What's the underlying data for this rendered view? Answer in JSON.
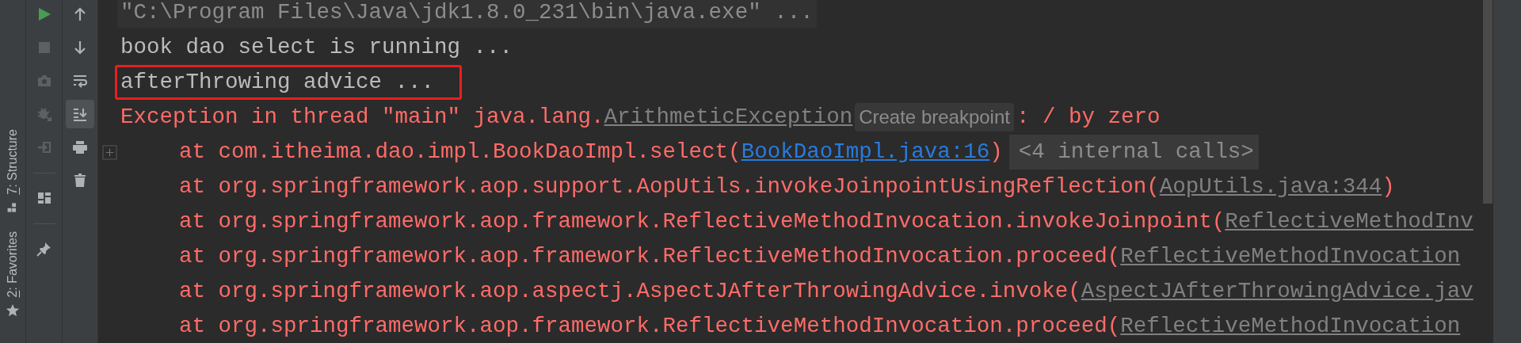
{
  "tool_stripe": [
    {
      "kind": "structure",
      "mnemonic": "7",
      "label": ": Structure"
    },
    {
      "kind": "favorites",
      "mnemonic": "2",
      "label": ": Favorites"
    }
  ],
  "run_toolbar": [
    {
      "kind": "run",
      "disabled": false
    },
    {
      "kind": "stop",
      "disabled": true
    },
    {
      "kind": "snapshot",
      "disabled": true
    },
    {
      "kind": "debug",
      "disabled": true
    },
    {
      "kind": "exit",
      "disabled": true
    },
    {
      "kind": "separator"
    },
    {
      "kind": "layout",
      "disabled": false
    },
    {
      "kind": "separator"
    },
    {
      "kind": "pin",
      "disabled": false
    }
  ],
  "console_toolbar": [
    {
      "kind": "up",
      "selected": false
    },
    {
      "kind": "down",
      "selected": false
    },
    {
      "kind": "soft_wrap",
      "selected": false
    },
    {
      "kind": "scroll_to_end",
      "selected": true
    },
    {
      "kind": "print",
      "selected": false
    },
    {
      "kind": "clear",
      "selected": false
    }
  ],
  "console": {
    "lines": [
      {
        "kind": "command",
        "highlighted": false,
        "segments": [
          {
            "kind": "text",
            "text": "\"C:\\Program Files\\Java\\jdk1.8.0_231\\bin\\java.exe\" ..."
          }
        ]
      },
      {
        "kind": "stdout",
        "highlighted": false,
        "segments": [
          {
            "kind": "text",
            "text": "book dao select is running ..."
          }
        ]
      },
      {
        "kind": "stdout",
        "highlighted": true,
        "segments": [
          {
            "kind": "text",
            "text": "afterThrowing advice ..."
          }
        ]
      },
      {
        "kind": "stderr",
        "highlighted": false,
        "segments": [
          {
            "kind": "text",
            "text": "Exception in thread \"main\" java.lang."
          },
          {
            "kind": "library_link",
            "text": "ArithmeticException"
          },
          {
            "kind": "hint",
            "text": "Create breakpoint"
          },
          {
            "kind": "text",
            "text": ": / by zero"
          }
        ]
      },
      {
        "kind": "frame",
        "highlighted": false,
        "fold": {
          "collapsed": true
        },
        "segments": [
          {
            "kind": "text",
            "text": "at com.itheima.dao.impl.BookDaoImpl.select("
          },
          {
            "kind": "source_link",
            "text": "BookDaoImpl.java:16"
          },
          {
            "kind": "text",
            "text": ")"
          },
          {
            "kind": "folded",
            "text": "<4 internal calls>"
          }
        ]
      },
      {
        "kind": "frame",
        "highlighted": false,
        "segments": [
          {
            "kind": "text",
            "text": "at org.springframework.aop.support.AopUtils.invokeJoinpointUsingReflection("
          },
          {
            "kind": "library_link",
            "text": "AopUtils.java:344"
          },
          {
            "kind": "text",
            "text": ")"
          }
        ]
      },
      {
        "kind": "frame",
        "highlighted": false,
        "segments": [
          {
            "kind": "text",
            "text": "at org.springframework.aop.framework.ReflectiveMethodInvocation.invokeJoinpoint("
          },
          {
            "kind": "library_link",
            "text": "ReflectiveMethodInv"
          }
        ]
      },
      {
        "kind": "frame",
        "highlighted": false,
        "segments": [
          {
            "kind": "text",
            "text": "at org.springframework.aop.framework.ReflectiveMethodInvocation.proceed("
          },
          {
            "kind": "library_link",
            "text": "ReflectiveMethodInvocation"
          }
        ]
      },
      {
        "kind": "frame",
        "highlighted": false,
        "segments": [
          {
            "kind": "text",
            "text": "at org.springframework.aop.aspectj.AspectJAfterThrowingAdvice.invoke("
          },
          {
            "kind": "library_link",
            "text": "AspectJAfterThrowingAdvice.jav"
          }
        ]
      },
      {
        "kind": "frame",
        "highlighted": false,
        "segments": [
          {
            "kind": "text",
            "text": "at org.springframework.aop.framework.ReflectiveMethodInvocation.proceed("
          },
          {
            "kind": "library_link",
            "text": "ReflectiveMethodInvocation"
          }
        ]
      }
    ]
  }
}
